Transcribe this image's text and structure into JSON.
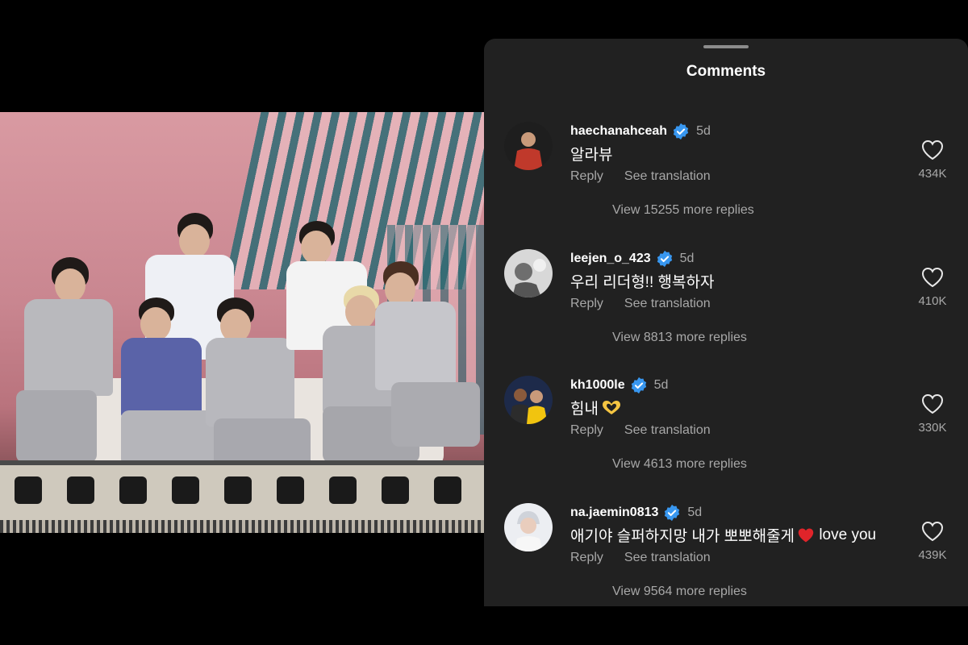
{
  "panel": {
    "title": "Comments"
  },
  "comments": [
    {
      "username": "haechanahceah",
      "time": "5d",
      "text": "알라뷰",
      "reply_label": "Reply",
      "translate_label": "See translation",
      "view_replies": "View 15255 more replies",
      "likes": "434K",
      "verified": true,
      "avatar_icon": "avatar-red-shirt"
    },
    {
      "username": "leejen_o_423",
      "time": "5d",
      "text": "우리 리더형!! 행복하자",
      "reply_label": "Reply",
      "translate_label": "See translation",
      "view_replies": "View 8813 more replies",
      "likes": "410K",
      "verified": true,
      "avatar_icon": "avatar-grayscale"
    },
    {
      "username": "kh1000le",
      "time": "5d",
      "text": "힘내",
      "text_emoji": "heart-hands-emoji",
      "reply_label": "Reply",
      "translate_label": "See translation",
      "view_replies": "View 4613 more replies",
      "likes": "330K",
      "verified": true,
      "avatar_icon": "avatar-basketball"
    },
    {
      "username": "na.jaemin0813",
      "time": "5d",
      "text_before_emoji": "애기야 슬퍼하지망 내가 뽀뽀해줄게",
      "text_emoji": "red-heart-emoji",
      "text_after_emoji": " love you",
      "reply_label": "Reply",
      "translate_label": "See translation",
      "view_replies": "View 9564 more replies",
      "likes": "439K",
      "verified": true,
      "avatar_icon": "avatar-light-hair"
    }
  ],
  "colors": {
    "panel_bg": "#212121",
    "muted_text": "#a8a8a8",
    "verified_blue": "#3897f0",
    "heart_red": "#e0242a"
  }
}
